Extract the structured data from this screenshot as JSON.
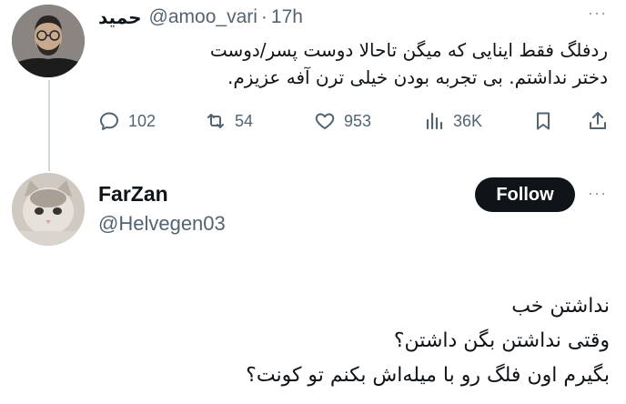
{
  "tweet1": {
    "author_name": "حمید",
    "handle": "@amoo_vari",
    "separator": "·",
    "time": "17h",
    "text_lines": [
      "ردفلگ فقط اینایی که میگن تاحالا دوست پسر/دوست",
      "دختر نداشتم. بی تجربه بودن خیلی ترن آفه عزیزم."
    ],
    "stats": {
      "replies": "102",
      "retweets": "54",
      "likes": "953",
      "views": "36K"
    },
    "more_glyph": "···"
  },
  "tweet2": {
    "author_name": "FarZan",
    "handle": "@Helvegen03",
    "follow_label": "Follow",
    "more_glyph": "···",
    "text_lines": [
      "نداشتن خب",
      "وقتی نداشتن بگن داشتن؟",
      "بگیرم اون فلگ رو با میله‌اش بکنم تو کونت؟"
    ]
  },
  "icons": {
    "reply": "reply-icon",
    "retweet": "retweet-icon",
    "like": "heart-icon",
    "views": "views-icon",
    "bookmark": "bookmark-icon",
    "share": "share-icon"
  },
  "colors": {
    "text_primary": "#0f1419",
    "text_secondary": "#536471",
    "thread_line": "#cfd9de",
    "follow_button": "#0f1419"
  }
}
